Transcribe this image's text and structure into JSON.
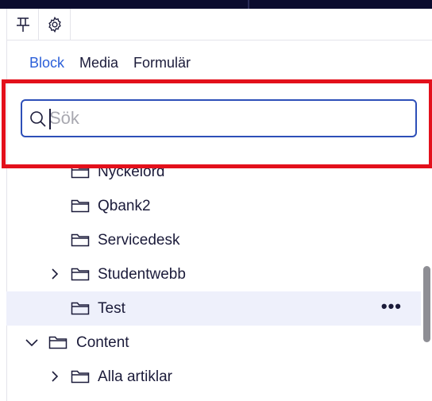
{
  "toolbar": {
    "pin_icon": "pin-icon",
    "settings_icon": "gear-icon"
  },
  "tabs": [
    {
      "label": "Block",
      "active": true
    },
    {
      "label": "Media",
      "active": false
    },
    {
      "label": "Formulär",
      "active": false
    }
  ],
  "search": {
    "placeholder": "Sök",
    "value": ""
  },
  "tree": [
    {
      "label": "Nyckelord",
      "level": 2,
      "expandable": false,
      "expanded": false,
      "selected": false
    },
    {
      "label": "Qbank2",
      "level": 2,
      "expandable": false,
      "expanded": false,
      "selected": false
    },
    {
      "label": "Servicedesk",
      "level": 2,
      "expandable": false,
      "expanded": false,
      "selected": false
    },
    {
      "label": "Studentwebb",
      "level": 2,
      "expandable": true,
      "expanded": false,
      "selected": false
    },
    {
      "label": "Test",
      "level": 2,
      "expandable": false,
      "expanded": false,
      "selected": true,
      "more": "•••"
    },
    {
      "label": "Content",
      "level": 1,
      "expandable": true,
      "expanded": true,
      "selected": false
    },
    {
      "label": "Alla artiklar",
      "level": 2,
      "expandable": true,
      "expanded": false,
      "selected": false
    }
  ],
  "colors": {
    "accent": "#2b5fd9",
    "highlight": "#e3101b",
    "selected_bg": "#eef0fb",
    "topbar": "#0b0c2e"
  }
}
